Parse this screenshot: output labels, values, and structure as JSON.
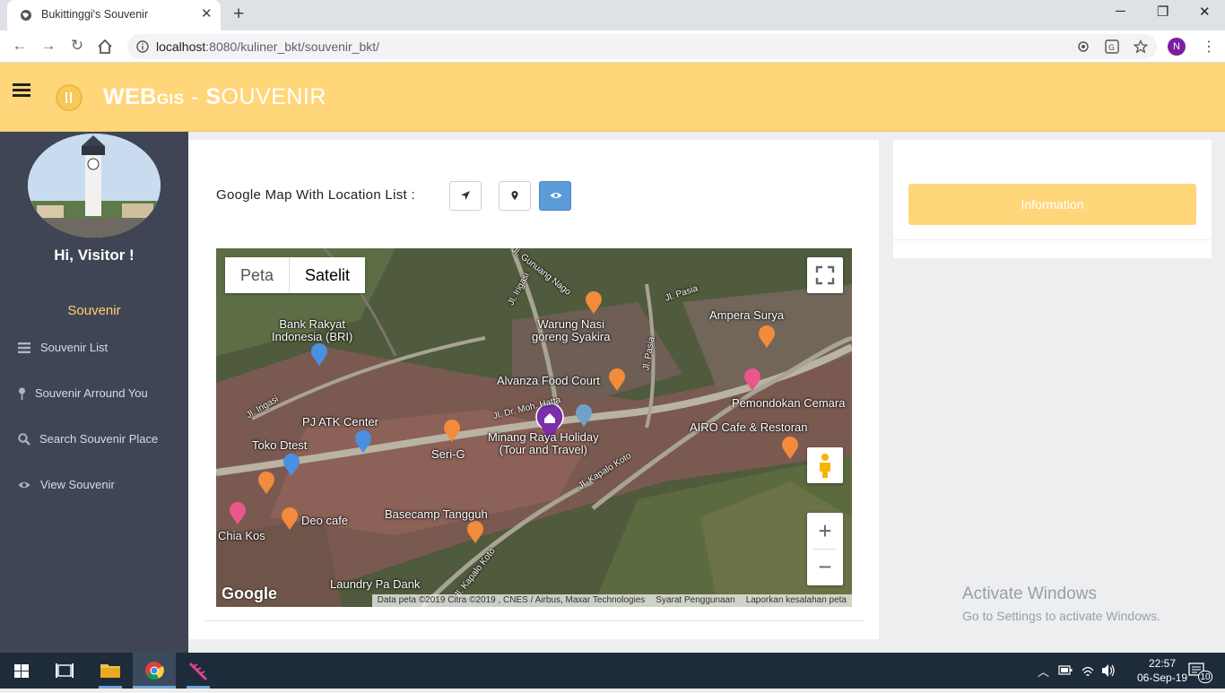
{
  "browser": {
    "tab_title": "Bukittinggi's Souvenir",
    "url_host": "localhost",
    "url_rest": ":8080/kuliner_bkt/souvenir_bkt/",
    "profile_initial": "N"
  },
  "header": {
    "brand_web": "WEB",
    "brand_gis": "GIS",
    "brand_sep": " - ",
    "brand_s": "S",
    "brand_rest": "OUVENIR"
  },
  "sidebar": {
    "greeting": "Hi, Visitor !",
    "section": "Souvenir",
    "items": [
      {
        "label": "Souvenir List",
        "icon": "list-icon"
      },
      {
        "label": "Souvenir Arround You",
        "icon": "map-pin-icon"
      },
      {
        "label": "Search Souvenir Place",
        "icon": "search-icon"
      },
      {
        "label": "View Souvenir",
        "icon": "eye-icon"
      }
    ]
  },
  "main": {
    "map_heading": "Google Map With Location List :",
    "info_button": "Information"
  },
  "map": {
    "type_buttons": [
      "Peta",
      "Satelit"
    ],
    "selected_type": "Satelit",
    "labels": {
      "bri": "Bank Rakyat\nIndonesia (BRI)",
      "warung": "Warung Nasi\ngoreng Syakira",
      "ampera": "Ampera Surya",
      "alvanza": "Alvanza Food Court",
      "pemondokan": "Pemondokan Cemara",
      "pjatk": "PJ ATK Center",
      "airo": "AIRO Cafe & Restoran",
      "minang": "Minang Raya Holiday\n(Tour and Travel)",
      "toko": "Toko Dtest",
      "serig": "Seri-G",
      "deo": "Deo cafe",
      "basecamp": "Basecamp Tangguh",
      "chia": "Chia Kos",
      "laundry": "Laundry Pa Dank"
    },
    "roads": {
      "gunuang": "Jl. Gunuang Nago",
      "irigasi1": "Jl. Irigasi",
      "pasia1": "Jl. Pasia",
      "pasia2": "Jl. Pasia",
      "irigasi2": "Jl. Irigasi",
      "mohhatta": "Jl. Dr. Moh. Hatta",
      "kapalo1": "Jl. Kapalo Koto",
      "kapalo2": "Jl. Kapalo Koto"
    },
    "google": "Google",
    "attribution": [
      "Data peta ©2019 Citra ©2019 , CNES / Airbus, Maxar Technologies",
      "Syarat Penggunaan",
      "Laporkan kesalahan peta"
    ]
  },
  "watermark": {
    "line1": "Activate Windows",
    "line2": "Go to Settings to activate Windows."
  },
  "taskbar": {
    "time": "22:57",
    "date": "06-Sep-19",
    "notifications": "10"
  },
  "colors": {
    "header": "#ffd67a",
    "sidebar": "#3f4554",
    "accent_blue": "#5b9bd8",
    "section_text": "#ffd270"
  }
}
